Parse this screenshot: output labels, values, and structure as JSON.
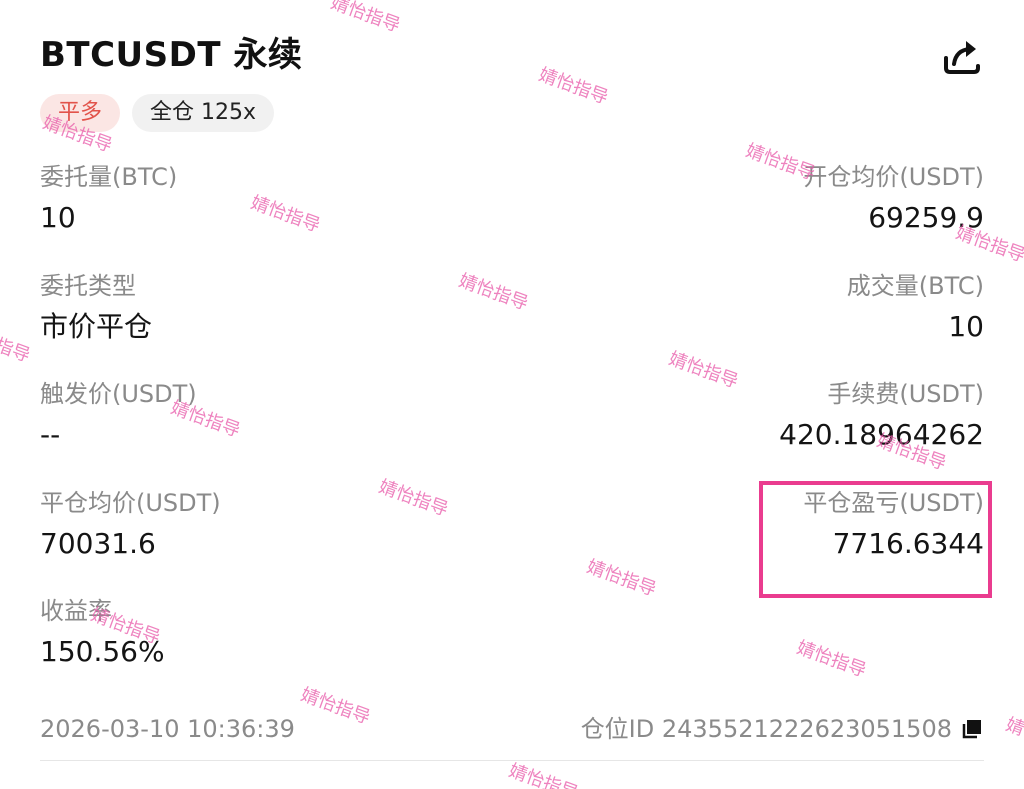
{
  "header": {
    "title": "BTCUSDT 永续"
  },
  "tags": {
    "side": "平多",
    "margin_mode": "全仓 125x"
  },
  "fields": {
    "order_qty": {
      "label": "委托量(BTC)",
      "value": "10"
    },
    "avg_open_price": {
      "label": "开仓均价(USDT)",
      "value": "69259.9"
    },
    "order_type": {
      "label": "委托类型",
      "value": "市价平仓"
    },
    "filled_qty": {
      "label": "成交量(BTC)",
      "value": "10"
    },
    "trigger_price": {
      "label": "触发价(USDT)",
      "value": "--"
    },
    "fee": {
      "label": "手续费(USDT)",
      "value": "420.18964262"
    },
    "avg_close_price": {
      "label": "平仓均价(USDT)",
      "value": "70031.6"
    },
    "close_pnl": {
      "label": "平仓盈亏(USDT)",
      "value": "7716.6344"
    },
    "roi": {
      "label": "收益率",
      "value": "150.56%"
    }
  },
  "footer": {
    "timestamp": "2026-03-10 10:36:39",
    "position_id": "仓位ID 2435521222623051508"
  },
  "watermark_text": "婧怡指导",
  "icons": {
    "share": "share-icon",
    "copy": "copy-icon"
  },
  "colors": {
    "side_tag_text": "#e2534a",
    "side_tag_bg": "#fbe6e4",
    "highlight_border": "#ea3c8f",
    "watermark": "#e85aaa"
  }
}
